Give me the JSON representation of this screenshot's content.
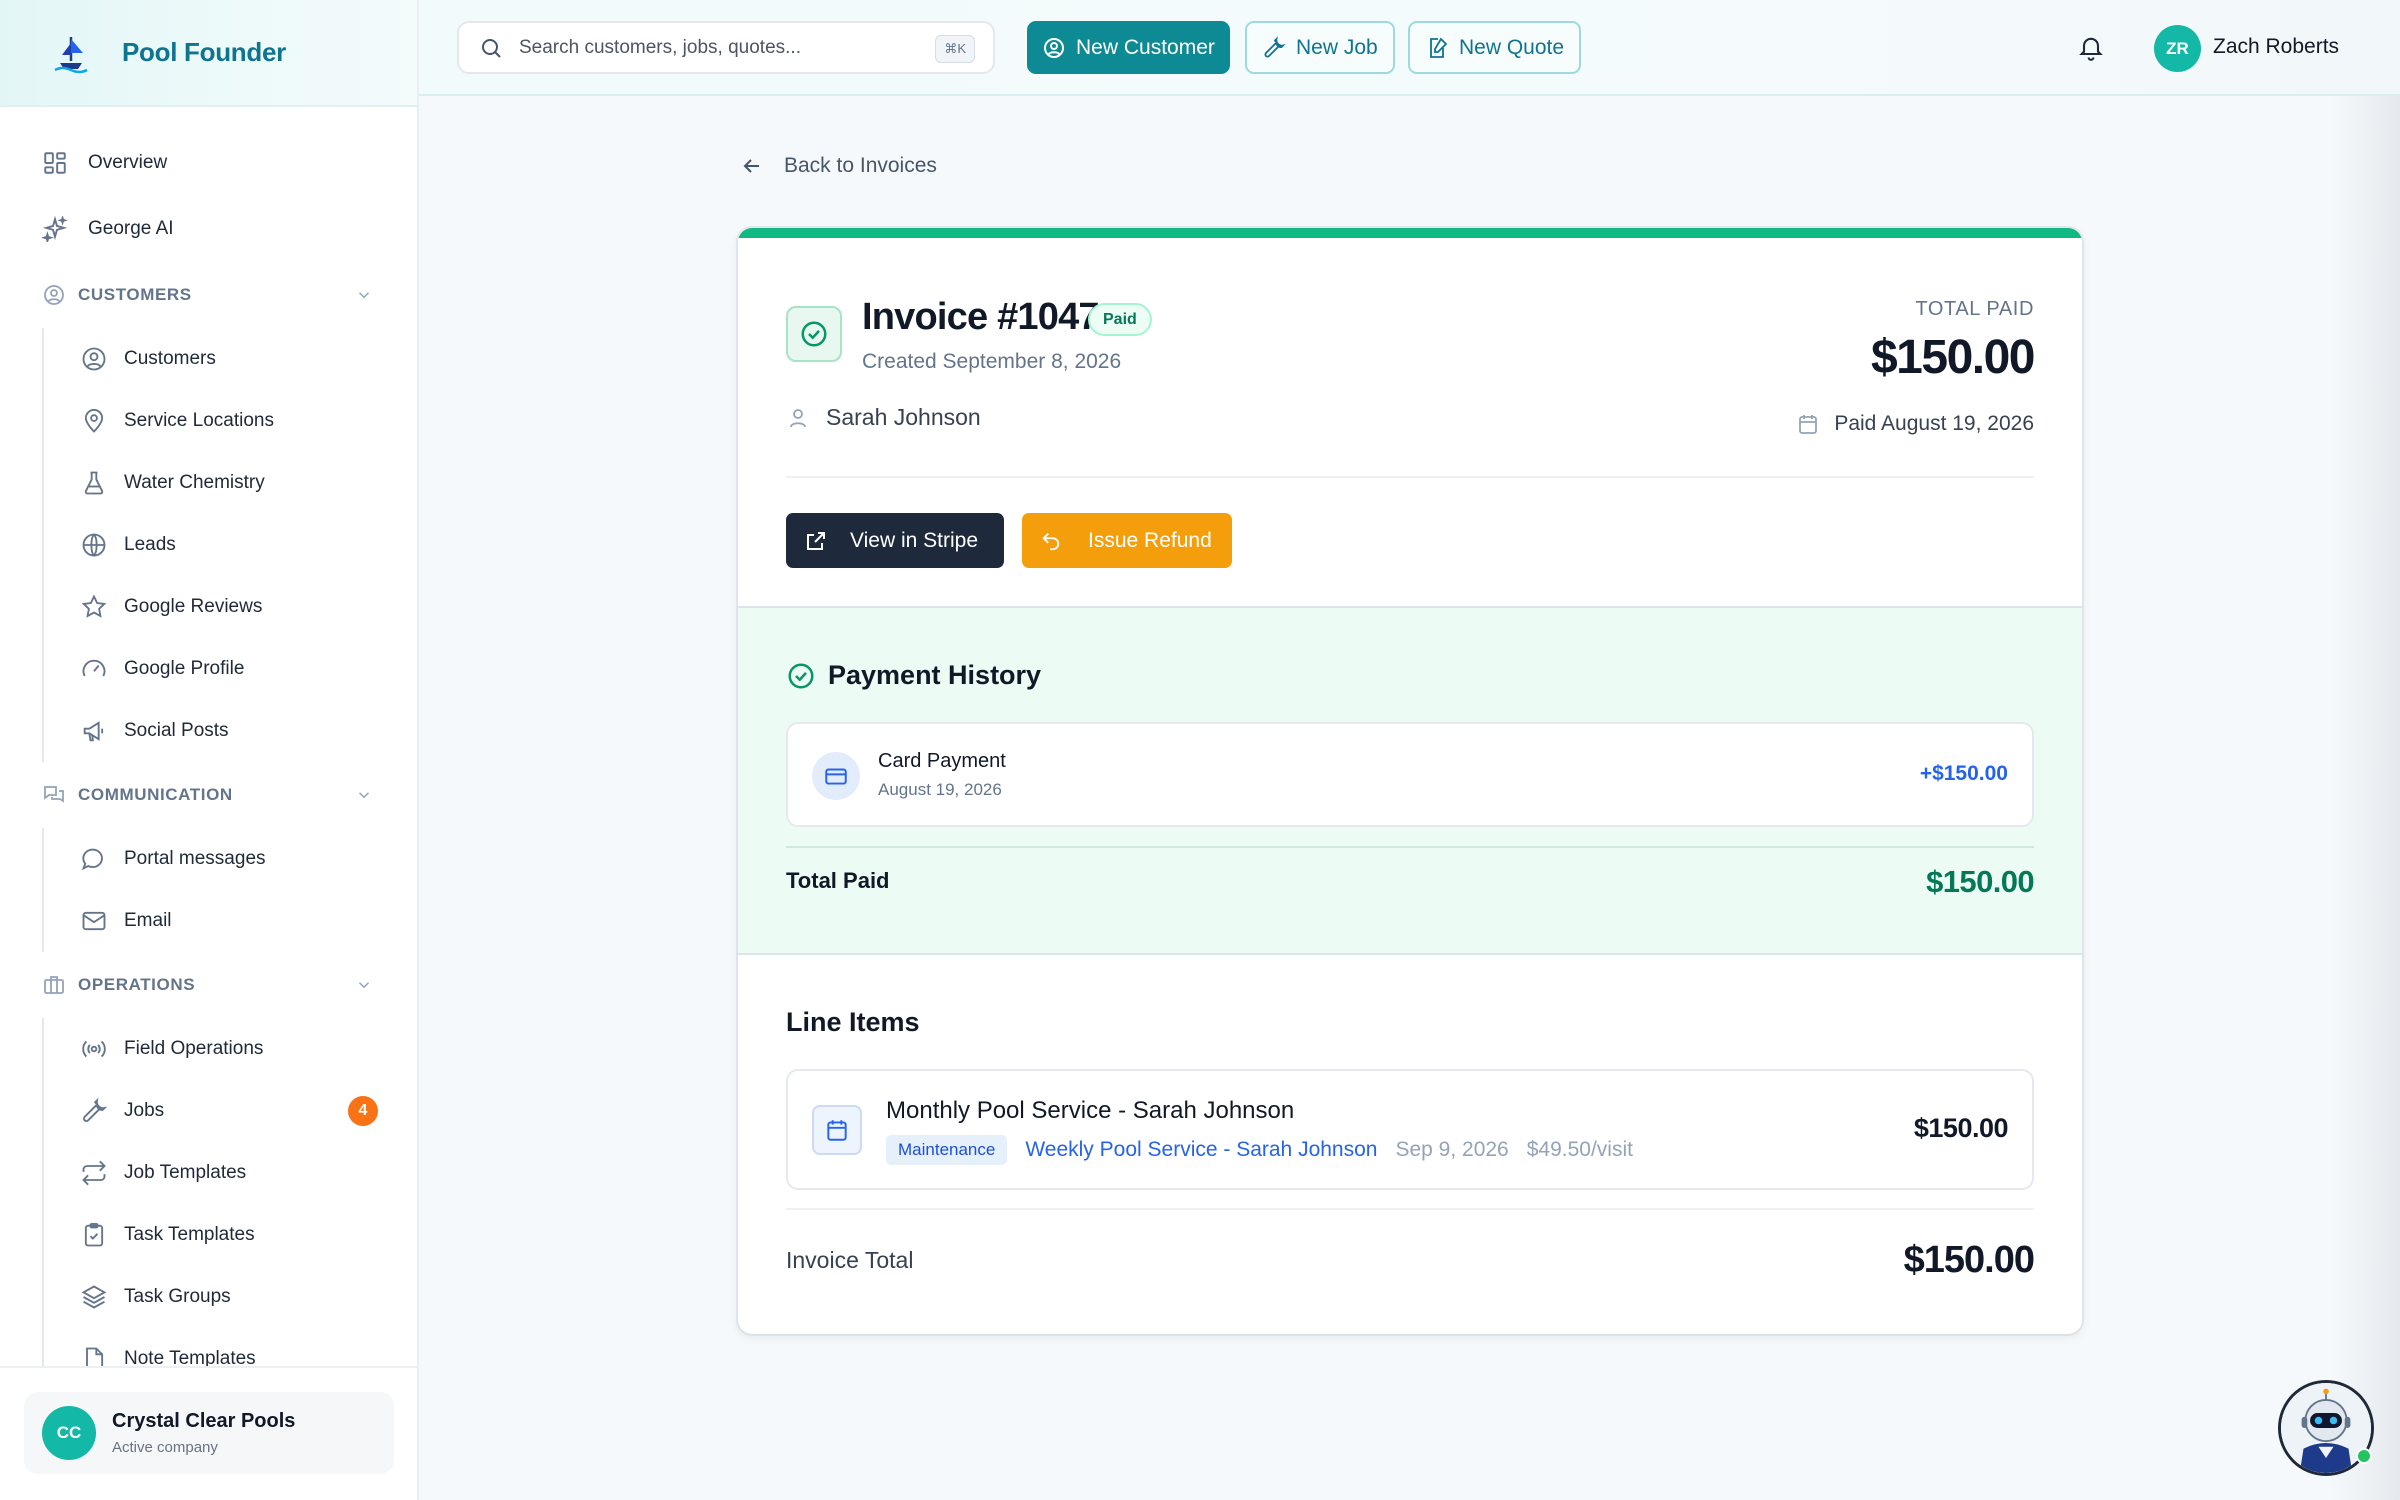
{
  "brand": {
    "name": "Pool Founder"
  },
  "sidebar": {
    "top_items": [
      {
        "label": "Overview",
        "icon": "grid-icon"
      },
      {
        "label": "George AI",
        "icon": "sparkles-icon"
      }
    ],
    "sections": [
      {
        "title": "CUSTOMERS",
        "items": [
          {
            "label": "Customers",
            "icon": "user-circle-icon"
          },
          {
            "label": "Service Locations",
            "icon": "map-pin-icon"
          },
          {
            "label": "Water Chemistry",
            "icon": "flask-icon"
          },
          {
            "label": "Leads",
            "icon": "globe-icon"
          },
          {
            "label": "Google Reviews",
            "icon": "star-icon"
          },
          {
            "label": "Google Profile",
            "icon": "gauge-icon"
          },
          {
            "label": "Social Posts",
            "icon": "megaphone-icon"
          }
        ]
      },
      {
        "title": "COMMUNICATION",
        "items": [
          {
            "label": "Portal messages",
            "icon": "chat-bubble-icon"
          },
          {
            "label": "Email",
            "icon": "mail-icon"
          }
        ]
      },
      {
        "title": "OPERATIONS",
        "items": [
          {
            "label": "Field Operations",
            "icon": "radio-icon"
          },
          {
            "label": "Jobs",
            "icon": "wrench-icon",
            "badge": "4"
          },
          {
            "label": "Job Templates",
            "icon": "repeat-icon"
          },
          {
            "label": "Task Templates",
            "icon": "clipboard-check-icon"
          },
          {
            "label": "Task Groups",
            "icon": "layers-icon"
          },
          {
            "label": "Note Templates",
            "icon": "file-icon"
          }
        ]
      }
    ],
    "company": {
      "initials": "CC",
      "name": "Crystal Clear Pools",
      "subtitle": "Active company"
    }
  },
  "topbar": {
    "search_placeholder": "Search customers, jobs, quotes...",
    "search_shortcut": "⌘K",
    "new_customer": "New Customer",
    "new_job": "New Job",
    "new_quote": "New Quote",
    "user_initials": "ZR",
    "user_name": "Zach Roberts"
  },
  "invoice": {
    "back_label": "Back to Invoices",
    "title": "Invoice #1047",
    "status": "Paid",
    "created": "Created September 8, 2026",
    "customer": "Sarah Johnson",
    "total_paid_label": "TOTAL PAID",
    "total_paid": "$150.00",
    "paid_date": "Paid August 19, 2026",
    "view_stripe_label": "View in Stripe",
    "refund_label": "Issue Refund"
  },
  "payment_history": {
    "title": "Payment History",
    "payments": [
      {
        "type": "Card Payment",
        "date": "August 19, 2026",
        "amount": "+$150.00"
      }
    ],
    "total_label": "Total Paid",
    "total_amount": "$150.00"
  },
  "line_items": {
    "title": "Line Items",
    "items": [
      {
        "name": "Monthly Pool Service - Sarah Johnson",
        "tag": "Maintenance",
        "link": "Weekly Pool Service - Sarah Johnson",
        "date": "Sep 9, 2026",
        "rate": "$49.50/visit",
        "amount": "$150.00"
      }
    ],
    "total_label": "Invoice Total",
    "total_amount": "$150.00"
  },
  "colors": {
    "accent": "#0e8a94",
    "brand": "#0e7490",
    "success": "#10b981",
    "warning": "#f59e0b",
    "link": "#2563eb",
    "badge": "#f97316"
  }
}
